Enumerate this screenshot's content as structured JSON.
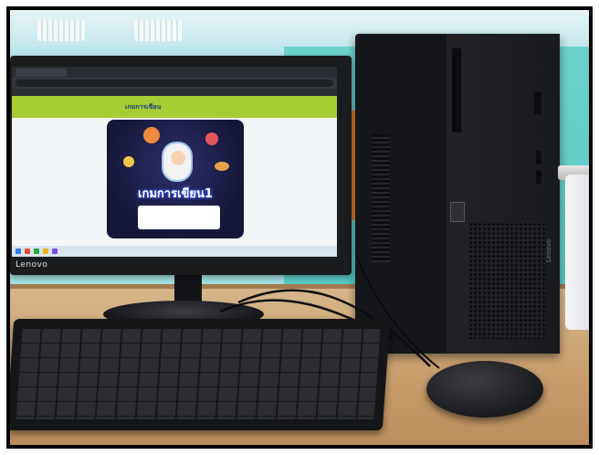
{
  "scene": {
    "description_type": "photo",
    "monitor_brand": "Lenovo",
    "tower_brand": "Lenovo"
  },
  "screen": {
    "tab_label": "",
    "url": "",
    "site_logo": "",
    "site_title": "เกมการเขียน",
    "banner_title": "เกมการเขียน1",
    "banner_subtitle_line1": "",
    "banner_subtitle_line2": ""
  },
  "colors": {
    "site_header": "#a7cc34",
    "wall": "#6fd3cf",
    "desk": "#c89d6b"
  }
}
